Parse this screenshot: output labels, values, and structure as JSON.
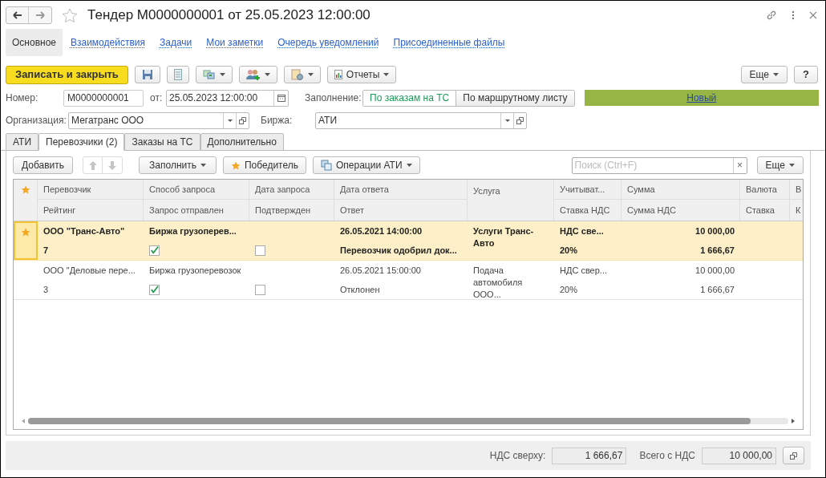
{
  "window": {
    "title": "Тендер М0000000001 от 25.05.2023 12:00:00"
  },
  "nav": [
    {
      "label": "Основное",
      "selected": true
    },
    {
      "label": "Взаимодействия",
      "selected": false
    },
    {
      "label": "Задачи",
      "selected": false
    },
    {
      "label": "Мои заметки",
      "selected": false
    },
    {
      "label": "Очередь уведомлений",
      "selected": false
    },
    {
      "label": "Присоединенные файлы",
      "selected": false
    }
  ],
  "toolbar": {
    "save_close": "Записать и закрыть",
    "reports": "Отчеты",
    "more": "Еще",
    "help": "?"
  },
  "form": {
    "number_label": "Номер:",
    "number": "М0000000001",
    "date_label": "от:",
    "date": "25.05.2023 12:00:00",
    "fill_label": "Заполнение:",
    "fill_options": [
      {
        "label": "По заказам на ТС",
        "selected": true
      },
      {
        "label": "По маршрутному листу",
        "selected": false
      }
    ],
    "status": "Новый",
    "org_label": "Организация:",
    "org": "Мегатранс ООО",
    "exchange_label": "Биржа:",
    "exchange": "АТИ"
  },
  "tabs": [
    {
      "label": "АТИ",
      "selected": false
    },
    {
      "label": "Перевозчики (2)",
      "selected": true
    },
    {
      "label": "Заказы на ТС",
      "selected": false
    },
    {
      "label": "Дополнительно",
      "selected": false
    }
  ],
  "table_toolbar": {
    "add": "Добавить",
    "fill": "Заполнить",
    "winner": "Победитель",
    "ati_ops": "Операции АТИ",
    "search_placeholder": "Поиск (Ctrl+F)",
    "clear": "×",
    "more": "Еще"
  },
  "table": {
    "columns": [
      [
        "Перевозчик",
        "Рейтинг"
      ],
      [
        "Способ запроса",
        "Запрос отправлен"
      ],
      [
        "Дата запроса",
        "Подтвержден"
      ],
      [
        "Дата ответа",
        "Ответ"
      ],
      [
        "Услуга",
        ""
      ],
      [
        "Учитыват...",
        "Ставка НДС"
      ],
      [
        "Сумма",
        "Сумма НДС"
      ],
      [
        "Валюта",
        "Ставка"
      ],
      [
        "В",
        "К"
      ]
    ],
    "rows": [
      {
        "selected": true,
        "winner": true,
        "carrier": "ООО \"Транс-Авто\"",
        "rating": "7",
        "method": "Биржа грузоперев...",
        "sent": true,
        "confirmed": false,
        "answer_date": "26.05.2021 14:00:00",
        "answer": "Перевозчик одобрил док...",
        "service": "Услуги Транс-Авто",
        "vat_mode": "НДС све...",
        "vat_rate": "20%",
        "sum": "10 000,00",
        "vat_sum": "1 666,67"
      },
      {
        "selected": false,
        "winner": false,
        "carrier": "ООО \"Деловые пере...",
        "rating": "3",
        "method": "Биржа грузоперевозок",
        "sent": true,
        "confirmed": false,
        "answer_date": "26.05.2021 15:00:00",
        "answer": "Отклонен",
        "service": "Подача автомобиля ООО...",
        "vat_mode": "НДС свер...",
        "vat_rate": "20%",
        "sum": "10 000,00",
        "vat_sum": "1 666,67"
      }
    ]
  },
  "footer": {
    "vat_label": "НДС сверху:",
    "vat": "1 666,67",
    "total_label": "Всего с НДС",
    "total": "10 000,00"
  }
}
